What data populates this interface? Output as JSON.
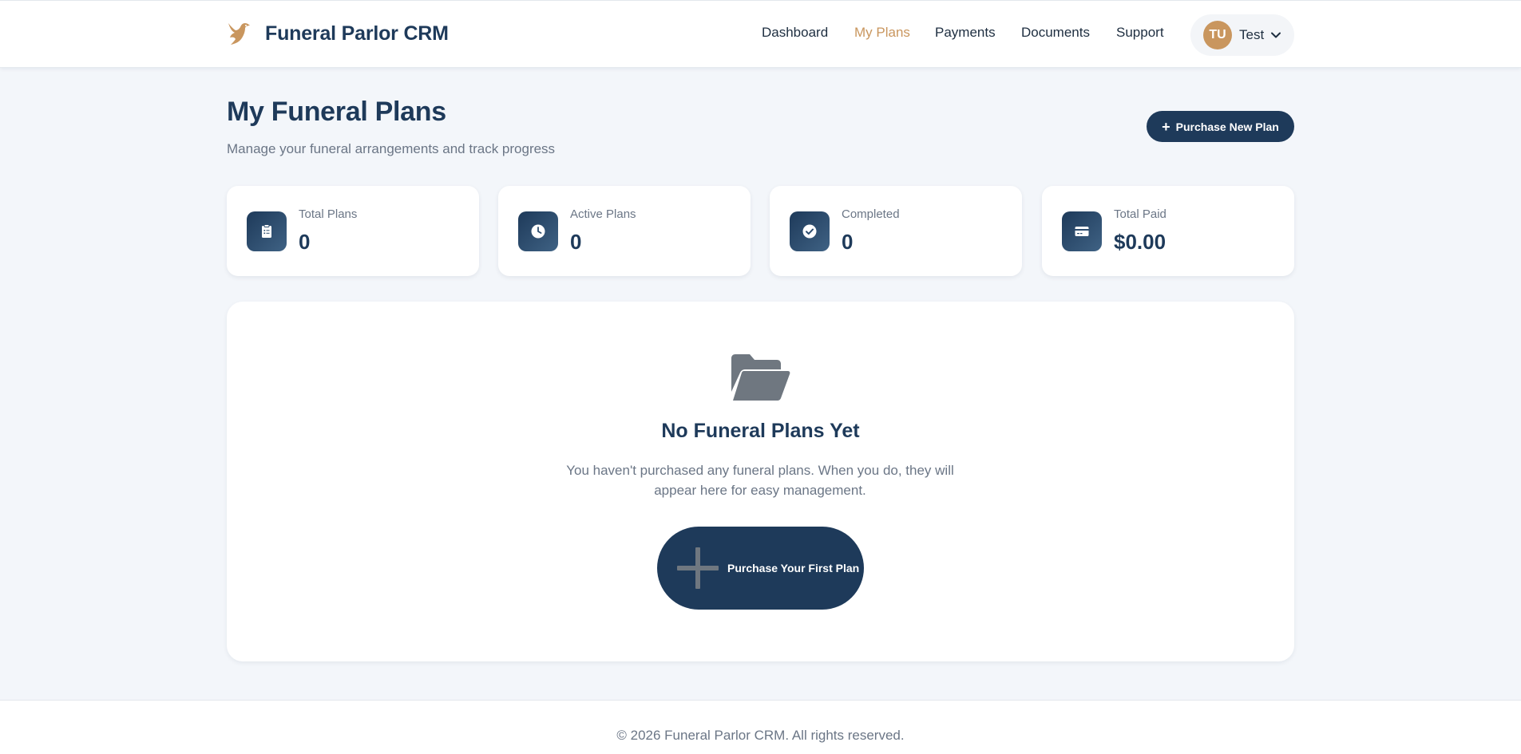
{
  "header": {
    "brand": "Funeral Parlor CRM",
    "logo_icon": "dove-icon",
    "nav": [
      {
        "label": "Dashboard",
        "active": false
      },
      {
        "label": "My Plans",
        "active": true
      },
      {
        "label": "Payments",
        "active": false
      },
      {
        "label": "Documents",
        "active": false
      },
      {
        "label": "Support",
        "active": false
      }
    ],
    "user": {
      "initials": "TU",
      "name": "Test",
      "dropdown_icon": "chevron-down-icon"
    }
  },
  "page": {
    "title": "My Funeral Plans",
    "subtitle": "Manage your funeral arrangements and track progress",
    "primary_action": "Purchase New Plan"
  },
  "stats": [
    {
      "label": "Total Plans",
      "value": "0",
      "icon": "clipboard-icon"
    },
    {
      "label": "Active Plans",
      "value": "0",
      "icon": "clock-icon"
    },
    {
      "label": "Completed",
      "value": "0",
      "icon": "check-circle-icon"
    },
    {
      "label": "Total Paid",
      "value": "$0.00",
      "icon": "credit-card-icon"
    }
  ],
  "empty_state": {
    "icon": "folder-open-icon",
    "title": "No Funeral Plans Yet",
    "text": "You haven't purchased any funeral plans. When you do, they will appear here for easy management.",
    "button_label": "Purchase Your First Plan"
  },
  "footer": {
    "text": "© 2026 Funeral Parlor CRM. All rights reserved."
  },
  "colors": {
    "primary": "#1e3a5a",
    "accent": "#c9965e",
    "background": "#f3f6fa",
    "muted_text": "#6b7686"
  }
}
